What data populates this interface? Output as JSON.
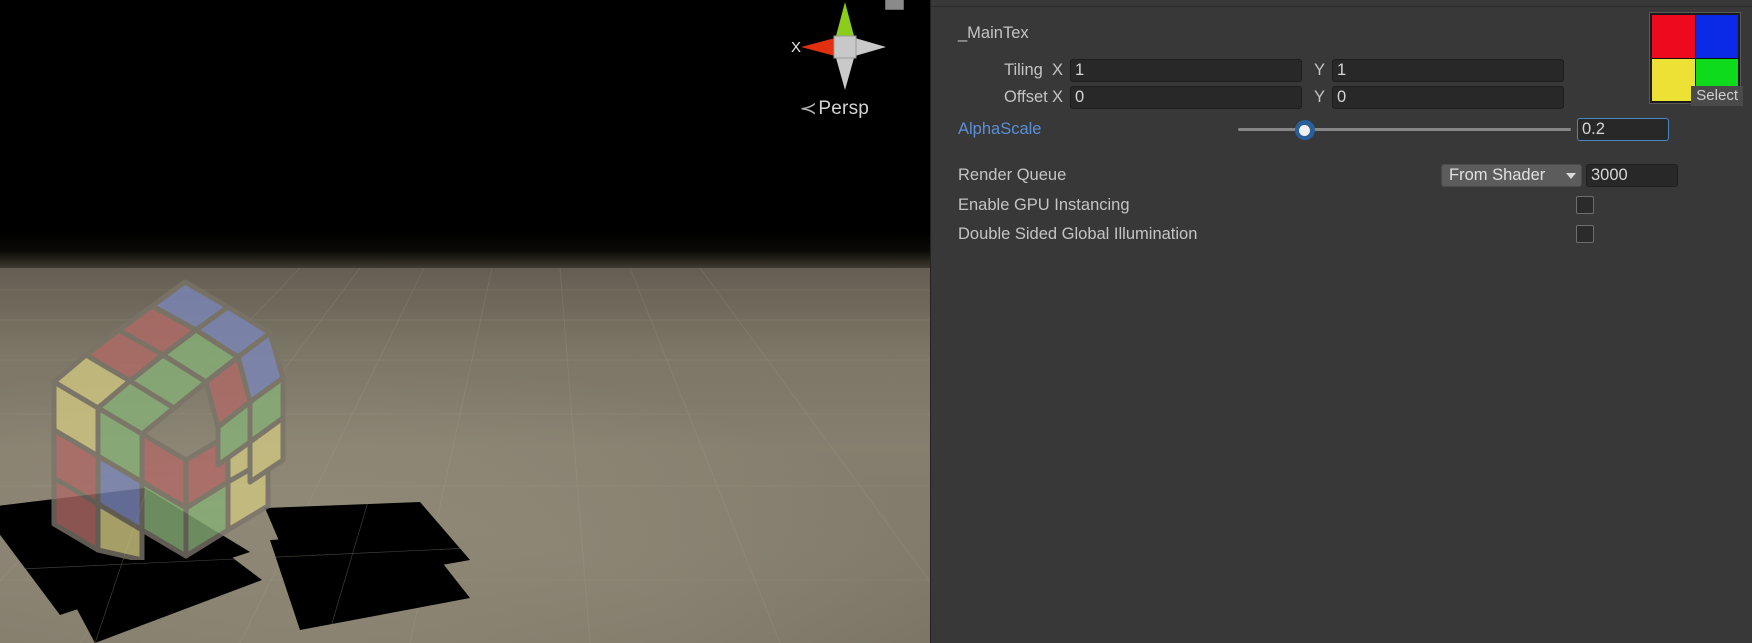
{
  "scene": {
    "gizmo": {
      "axis_x_label": "X",
      "projection_label": "Persp",
      "projection_chevron": "≺",
      "axis_colors": {
        "x": "#e03010",
        "y": "#8ccc1a",
        "neutral": "#c9c9c9",
        "center_cube": "#c8c8c8"
      }
    },
    "view_icon_name": "camera-view-icon",
    "background": {
      "sky_color": "#000000",
      "ground_color": "#8e8776",
      "grid_color": "#9a9383"
    },
    "object": {
      "name": "transparent-rubiks-cube",
      "face_colors": {
        "red": "#b06a66",
        "blue": "#7b86b8",
        "green": "#87b077",
        "yellow": "#cfc680",
        "edge": "#7a7468"
      },
      "shadow_color": "#000000"
    }
  },
  "inspector": {
    "texture_property": {
      "name_label": "_MainTex",
      "tiling_label": "Tiling",
      "offset_label": "Offset",
      "axis_x_label": "X",
      "axis_y_label": "Y",
      "tiling_x": "1",
      "tiling_y": "1",
      "offset_x": "0",
      "offset_y": "0",
      "select_button_label": "Select",
      "preview_swatch": {
        "top_left": "#ee0a1e",
        "top_right": "#0b2ae8",
        "bottom_left": "#eee136",
        "bottom_right": "#0ddb1b"
      }
    },
    "alpha_scale": {
      "label": "AlphaScale",
      "label_color": "#5b8fd6",
      "value": "0.2",
      "slider_percent": 20,
      "slider_min": 0,
      "slider_max": 1,
      "accent_color": "#2a6099"
    },
    "render_queue": {
      "label": "Render Queue",
      "mode_value": "From Shader",
      "queue_value": "3000"
    },
    "gpu_instancing": {
      "label": "Enable GPU Instancing",
      "checked": false
    },
    "double_sided_gi": {
      "label": "Double Sided Global Illumination",
      "checked": false
    }
  }
}
